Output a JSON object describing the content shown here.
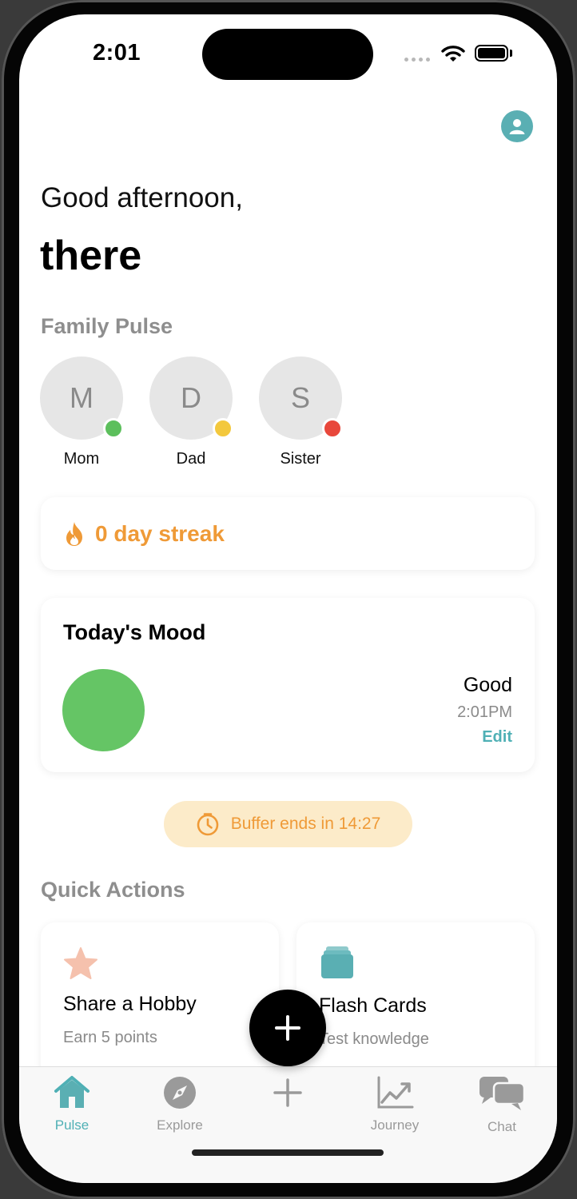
{
  "status": {
    "time": "2:01"
  },
  "header": {
    "greeting": "Good afternoon,",
    "name": "there"
  },
  "family": {
    "title": "Family Pulse",
    "members": [
      {
        "initial": "M",
        "label": "Mom",
        "status_color": "#5cbf5c"
      },
      {
        "initial": "D",
        "label": "Dad",
        "status_color": "#f3c83d"
      },
      {
        "initial": "S",
        "label": "Sister",
        "status_color": "#e8473b"
      }
    ]
  },
  "streak": {
    "text": "0 day streak",
    "icon": "flame-icon"
  },
  "mood": {
    "title": "Today's Mood",
    "label": "Good",
    "time": "2:01PM",
    "edit_label": "Edit",
    "color": "#65c565"
  },
  "buffer": {
    "text": "Buffer ends in 14:27",
    "icon": "timer-icon"
  },
  "quick_actions": {
    "title": "Quick Actions",
    "items": [
      {
        "title": "Share a Hobby",
        "subtitle": "Earn 5 points",
        "icon": "star-icon"
      },
      {
        "title": "Flash Cards",
        "subtitle": "Test knowledge",
        "icon": "cards-icon"
      }
    ]
  },
  "tabs": [
    {
      "label": "Pulse",
      "icon": "home-icon",
      "active": true
    },
    {
      "label": "Explore",
      "icon": "compass-icon",
      "active": false
    },
    {
      "label": "",
      "icon": "plus-icon",
      "active": false
    },
    {
      "label": "Journey",
      "icon": "chart-icon",
      "active": false
    },
    {
      "label": "Chat",
      "icon": "chat-icon",
      "active": false
    }
  ],
  "colors": {
    "accent": "#4fb0b5",
    "streak": "#ef9a37",
    "buffer_bg": "#fcebc9"
  }
}
